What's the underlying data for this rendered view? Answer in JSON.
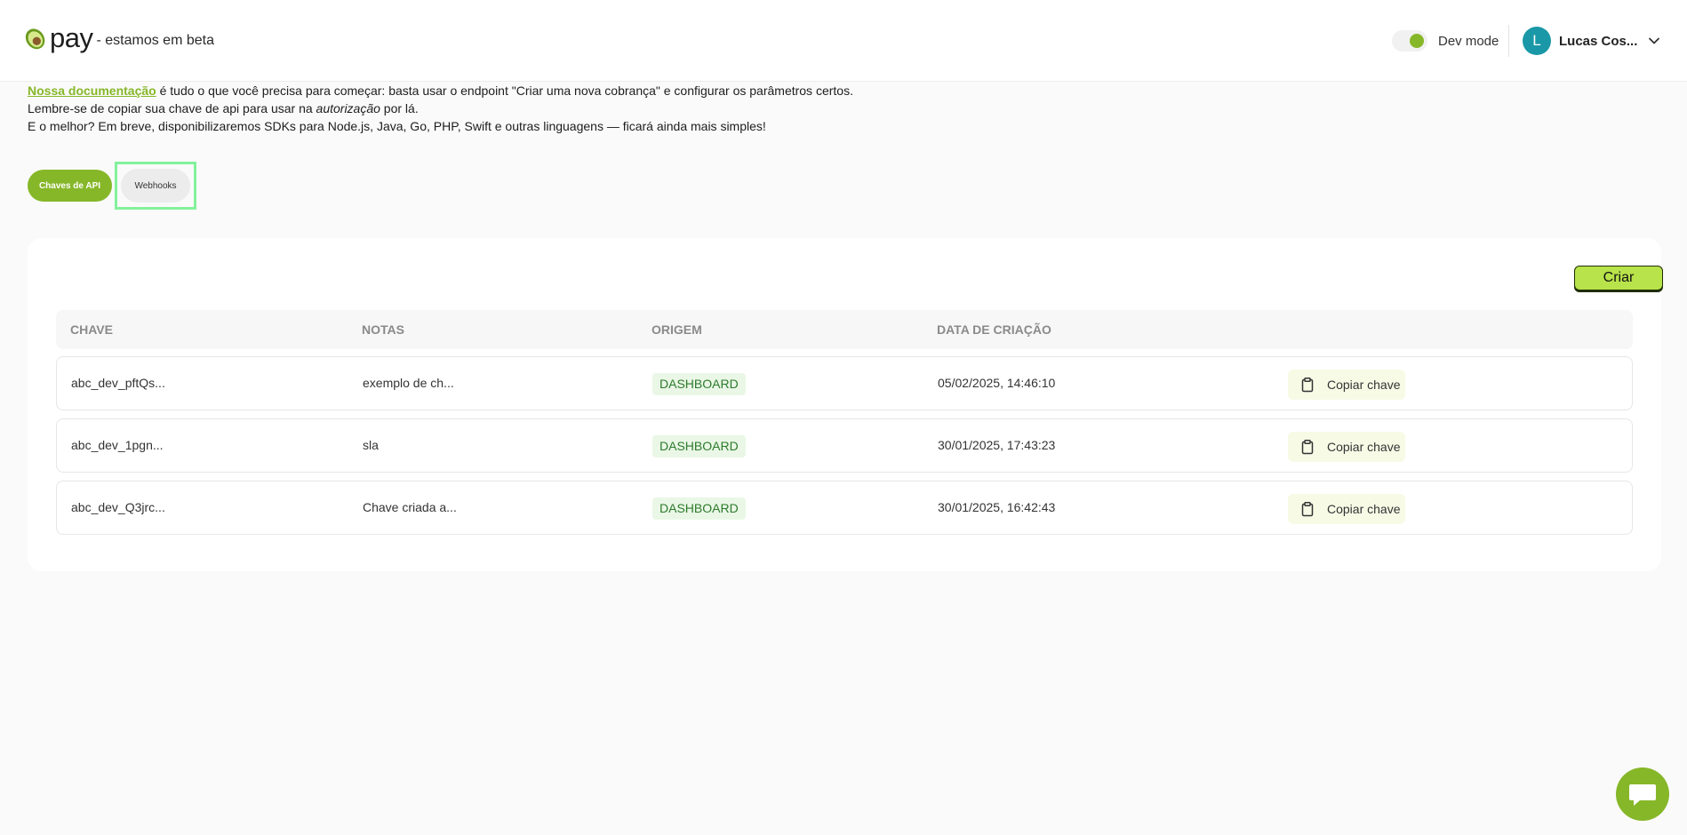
{
  "brand": {
    "logo_text": "pay",
    "tagline": "- estamos em beta"
  },
  "header": {
    "dev_mode_label": "Dev mode",
    "dev_mode_on": true,
    "avatar_initial": "L",
    "user_name": "Lucas Cos..."
  },
  "intro": {
    "doc_link": "Nossa documentação",
    "line1_rest": " é tudo o que você precisa para começar: basta usar o endpoint \"Criar uma nova cobrança\" e configurar os parâmetros certos.",
    "line2_pre": "Lembre-se de copiar sua chave de api para usar na ",
    "line2_em": "autorização",
    "line2_post": " por lá.",
    "line3": "E o melhor? Em breve, disponibilizaremos SDKs para Node.js, Java, Go, PHP, Swift e outras linguagens — ficará ainda mais simples!"
  },
  "tabs": {
    "api_keys": "Chaves de API",
    "webhooks": "Webhooks"
  },
  "table": {
    "create_label": "Criar",
    "columns": {
      "key": "CHAVE",
      "notes": "NOTAS",
      "origin": "ORIGEM",
      "created": "DATA DE CRIAÇÃO"
    },
    "copy_label": "Copiar chave",
    "rows": [
      {
        "key": "abc_dev_pftQs...",
        "notes": "exemplo de ch...",
        "origin": "DASHBOARD",
        "created": "05/02/2025, 14:46:10"
      },
      {
        "key": "abc_dev_1pgn...",
        "notes": "sla",
        "origin": "DASHBOARD",
        "created": "30/01/2025, 17:43:23"
      },
      {
        "key": "abc_dev_Q3jrc...",
        "notes": "Chave criada a...",
        "origin": "DASHBOARD",
        "created": "30/01/2025, 16:42:43"
      }
    ]
  },
  "colors": {
    "accent": "#86b729",
    "create_button": "#b8e34a",
    "avatar": "#1a98a7",
    "badge_bg": "#eaf7e6",
    "focus_ring": "#82f29a"
  },
  "icons": {
    "logo": "avocado-icon",
    "chevron": "chevron-down-icon",
    "copy": "clipboard-icon",
    "chat": "chat-bubble-icon"
  }
}
